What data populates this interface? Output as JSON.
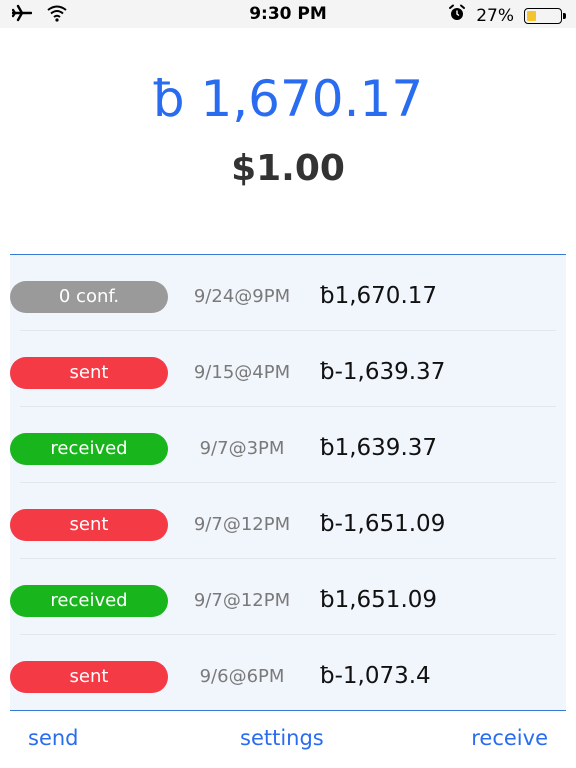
{
  "status_bar": {
    "time": "9:30 PM",
    "battery": "27%"
  },
  "balance": {
    "btc": "ƀ 1,670.17",
    "usd": "$1.00"
  },
  "transactions": [
    {
      "status": "0 conf.",
      "type": "conf",
      "date": "9/24@9PM",
      "amount": "ƀ1,670.17"
    },
    {
      "status": "sent",
      "type": "sent",
      "date": "9/15@4PM",
      "amount": "ƀ-1,639.37"
    },
    {
      "status": "received",
      "type": "received",
      "date": "9/7@3PM",
      "amount": "ƀ1,639.37"
    },
    {
      "status": "sent",
      "type": "sent",
      "date": "9/7@12PM",
      "amount": "ƀ-1,651.09"
    },
    {
      "status": "received",
      "type": "received",
      "date": "9/7@12PM",
      "amount": "ƀ1,651.09"
    },
    {
      "status": "sent",
      "type": "sent",
      "date": "9/6@6PM",
      "amount": "ƀ-1,073.4"
    }
  ],
  "tabbar": {
    "send": "send",
    "settings": "settings",
    "receive": "receive"
  },
  "colors": {
    "accent": "#2a6cf0",
    "sent": "#f33a45",
    "received": "#19b51d",
    "unconfirmed": "#9a9a9a"
  },
  "icons": {
    "airplane": "airplane-icon",
    "wifi": "wifi-icon",
    "alarm": "alarm-icon",
    "battery": "battery-icon"
  }
}
